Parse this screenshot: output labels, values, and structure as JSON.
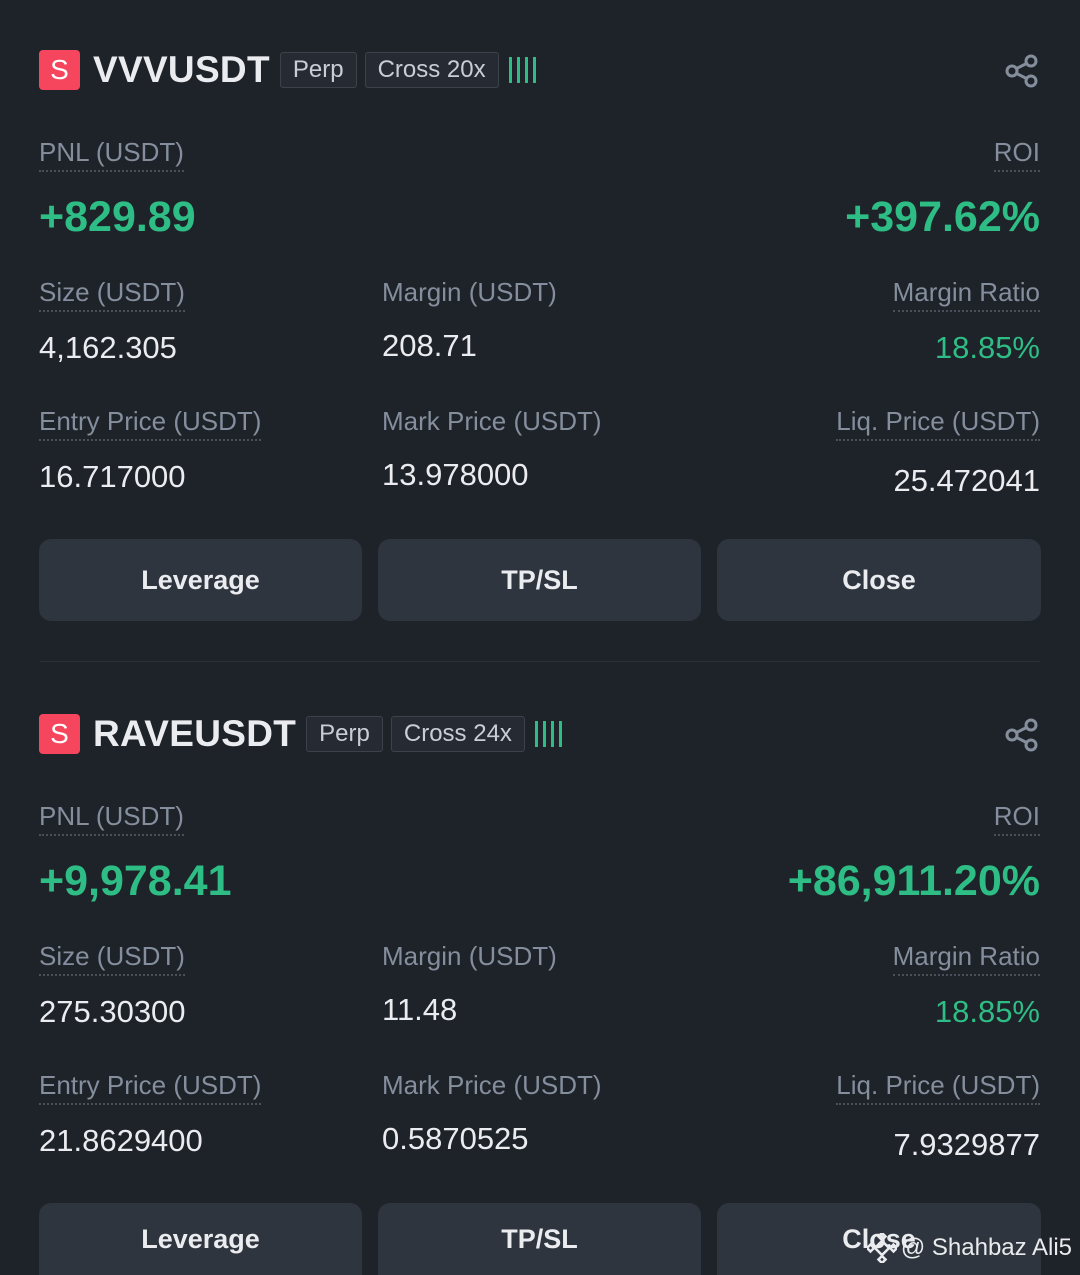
{
  "positions": [
    {
      "side": "S",
      "symbol": "VVVUSDT",
      "type_tag": "Perp",
      "margin_tag": "Cross 20x",
      "pnl_label": "PNL (USDT)",
      "pnl_value": "+829.89",
      "roi_label": "ROI",
      "roi_value": "+397.62%",
      "size_label": "Size (USDT)",
      "size_value": "4,162.305",
      "margin_label": "Margin (USDT)",
      "margin_value": "208.71",
      "margin_ratio_label": "Margin Ratio",
      "margin_ratio_value": "18.85%",
      "entry_label": "Entry Price (USDT)",
      "entry_value": "16.717000",
      "mark_label": "Mark Price (USDT)",
      "mark_value": "13.978000",
      "liq_label": "Liq. Price (USDT)",
      "liq_value": "25.472041",
      "buttons": {
        "leverage": "Leverage",
        "tpsl": "TP/SL",
        "close": "Close"
      }
    },
    {
      "side": "S",
      "symbol": "RAVEUSDT",
      "type_tag": "Perp",
      "margin_tag": "Cross 24x",
      "pnl_label": "PNL (USDT)",
      "pnl_value": "+9,978.41",
      "roi_label": "ROI",
      "roi_value": "+86,911.20%",
      "size_label": "Size (USDT)",
      "size_value": "275.30300",
      "margin_label": "Margin (USDT)",
      "margin_value": "11.48",
      "margin_ratio_label": "Margin Ratio",
      "margin_ratio_value": "18.85%",
      "entry_label": "Entry Price (USDT)",
      "entry_value": "21.8629400",
      "mark_label": "Mark Price (USDT)",
      "mark_value": "0.5870525",
      "liq_label": "Liq. Price (USDT)",
      "liq_value": "7.9329877",
      "buttons": {
        "leverage": "Leverage",
        "tpsl": "TP/SL",
        "close": "Close"
      }
    }
  ],
  "colors": {
    "background": "#1e2229",
    "profit": "#2ebd85",
    "short": "#f6465d",
    "button": "#2f353e"
  },
  "icons": {
    "share": "share-icon",
    "risk": "risk-bars-icon"
  },
  "watermark": "@ Shahbaz Ali5"
}
